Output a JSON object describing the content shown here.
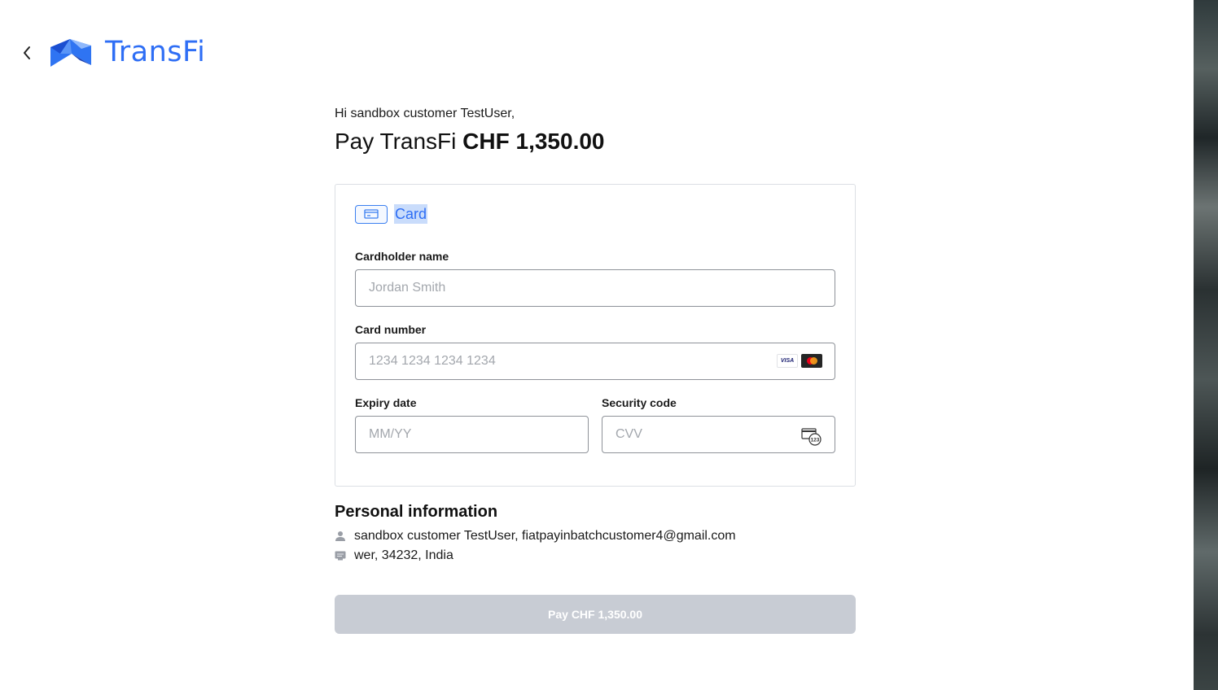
{
  "header": {
    "back_icon": "chevron-left-icon",
    "logo_icon": "transfi-logo-mark",
    "brand_name": "TransFi",
    "brand_color": "#2e6ef5"
  },
  "greeting": "Hi sandbox customer TestUser,",
  "payment": {
    "prefix": "Pay TransFi",
    "amount": "CHF 1,350.00"
  },
  "payment_method": {
    "icon": "credit-card-icon",
    "label": "Card",
    "selected": true
  },
  "form": {
    "cardholder": {
      "label": "Cardholder name",
      "placeholder": "Jordan Smith",
      "value": ""
    },
    "card_number": {
      "label": "Card number",
      "placeholder": "1234 1234 1234 1234",
      "value": "",
      "brands": [
        "visa-icon",
        "mastercard-icon"
      ],
      "visa_text": "VISA"
    },
    "expiry": {
      "label": "Expiry date",
      "placeholder": "MM/YY",
      "value": ""
    },
    "security": {
      "label": "Security code",
      "placeholder": "CVV",
      "value": "",
      "icon": "cvv-card-icon",
      "icon_text": "123"
    }
  },
  "personal_info": {
    "title": "Personal information",
    "user_line": "sandbox customer TestUser, fiatpayinbatchcustomer4@gmail.com",
    "user_icon": "user-icon",
    "address_line": "wer, 34232, India",
    "address_icon": "address-card-icon"
  },
  "pay_button": {
    "label": "Pay CHF 1,350.00",
    "disabled": true,
    "color": "#c8ccd4"
  }
}
